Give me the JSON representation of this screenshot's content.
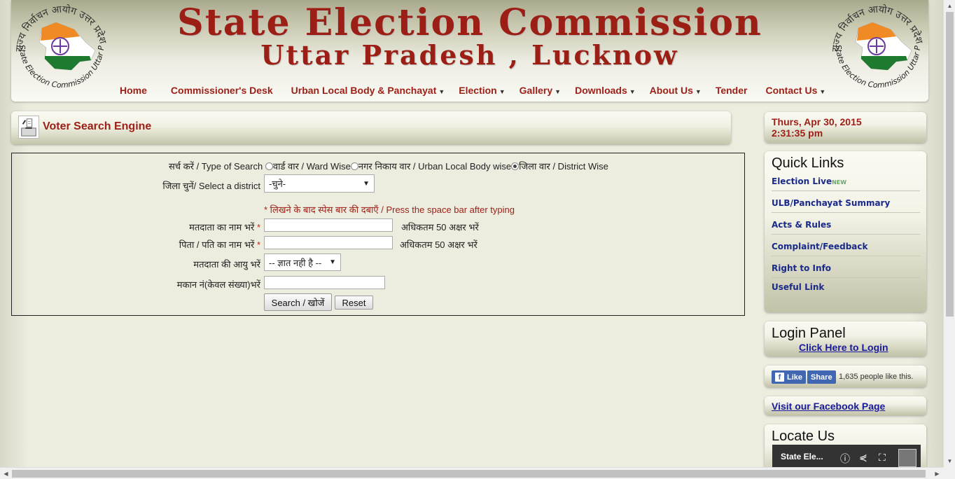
{
  "header": {
    "title": "State Election Commission",
    "subtitle": "Uttar Pradesh , Lucknow",
    "logo_text_top": "राज्य निर्वाचन आयोग उत्तर प्रदेश",
    "logo_text_bottom": "State Election Commission Uttar Pradesh"
  },
  "nav": [
    {
      "label": "Home",
      "dropdown": false
    },
    {
      "label": "Commissioner's Desk",
      "dropdown": false
    },
    {
      "label": "Urban Local Body & Panchayat",
      "dropdown": true
    },
    {
      "label": "Election",
      "dropdown": true
    },
    {
      "label": "Gallery",
      "dropdown": true
    },
    {
      "label": "Downloads",
      "dropdown": true
    },
    {
      "label": "About Us",
      "dropdown": true
    },
    {
      "label": "Tender",
      "dropdown": false
    },
    {
      "label": "Contact Us",
      "dropdown": true
    }
  ],
  "voter_search": {
    "title": "Voter Search Engine",
    "type_label": "सर्च करें / Type of Search",
    "radio_ward": "वार्ड वार / Ward Wise",
    "radio_ulb": "नगर निकाय वार / Urban Local Body wise",
    "radio_district": "जिला वार / District Wise",
    "selected_radio": "district",
    "district_label": "जिला चुनें/  Select a district",
    "district_value": "-चुने-",
    "hint": "* लिखने के बाद स्पेस बार की दबाएँ / Press the space bar after typing",
    "voter_name_label": "मतदाता का नाम भरें",
    "voter_name_value": "",
    "voter_name_limit": "अधिकतम 50 अक्षर भरें",
    "father_name_label": "पिता / पति का नाम भरें",
    "father_name_value": "",
    "father_name_limit": "अधिकतम 50 अक्षर भरें",
    "age_label": "मतदाता की आयु भरें",
    "age_value": "-- ज्ञात नही है --",
    "house_label": "मकान नं(केवल संख्या)भरें",
    "house_value": "",
    "required_mark": "*",
    "search_button": "Search / खोजें",
    "reset_button": "Reset"
  },
  "sidebar": {
    "date": "Thurs, Apr 30, 2015",
    "time": "2:31:35 pm",
    "quick_links_title": "Quick Links",
    "quick_links": [
      "Election Live",
      "ULB/Panchayat Summary",
      "Acts & Rules",
      "Complaint/Feedback",
      "Right to Info",
      "Useful Link"
    ],
    "live_badge": "NEW",
    "login_title": "Login Panel",
    "login_link": "Click Here to Login",
    "fb_like": "Like",
    "fb_share": "Share",
    "fb_count": "1,635 people like this.",
    "fb_page_link": "Visit our Facebook Page",
    "locate_title": "Locate Us",
    "map_title": "State Ele..."
  },
  "colors": {
    "brand_red": "#9c1f16",
    "link_blue": "#1a2a8a"
  }
}
